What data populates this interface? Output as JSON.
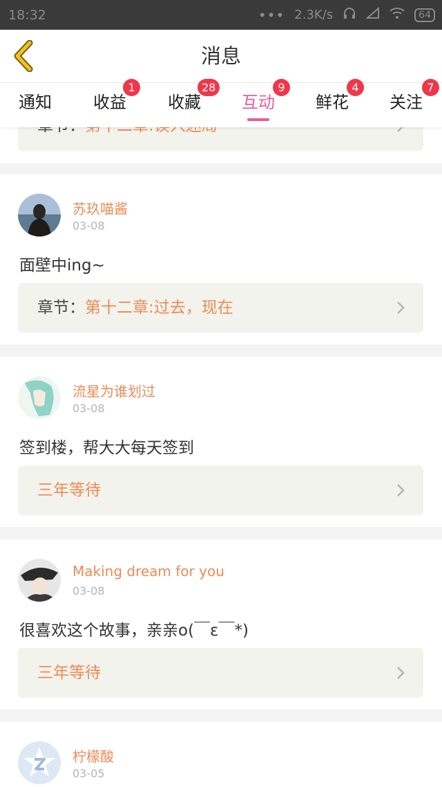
{
  "status_bar": {
    "time": "18:32",
    "dots": "•••",
    "net_speed": "2.3K/s",
    "battery": "64"
  },
  "header": {
    "title": "消息"
  },
  "tabs": [
    {
      "label": "通知",
      "badge": ""
    },
    {
      "label": "收益",
      "badge": "1"
    },
    {
      "label": "收藏",
      "badge": "28"
    },
    {
      "label": "互动",
      "badge": "9",
      "active": true
    },
    {
      "label": "鲜花",
      "badge": "4"
    },
    {
      "label": "关注",
      "badge": "7"
    }
  ],
  "partial_card": {
    "chapter_label": "章节：",
    "chapter_name": "第十二章:误入迷局"
  },
  "messages": [
    {
      "username": "苏玖喵酱",
      "date": "03-08",
      "comment": "面壁中ing~",
      "chapter_label": "章节：",
      "chapter_name": "第十二章:过去，现在"
    },
    {
      "username": "流星为谁划过",
      "date": "03-08",
      "comment": "签到楼，帮大大每天签到",
      "chapter_label": "",
      "chapter_name": "三年等待"
    },
    {
      "username": "Making dream for you",
      "date": "03-08",
      "comment": "很喜欢这个故事，亲亲o(￣ε￣*)",
      "chapter_label": "",
      "chapter_name": "三年等待"
    },
    {
      "username": "柠檬酸",
      "date": "03-05"
    }
  ],
  "colors": {
    "accent_pink": "#e85d95",
    "username_orange": "#ee8a56",
    "badge_red": "#f0364a",
    "back_arrow_yellow": "#f2c21d"
  }
}
